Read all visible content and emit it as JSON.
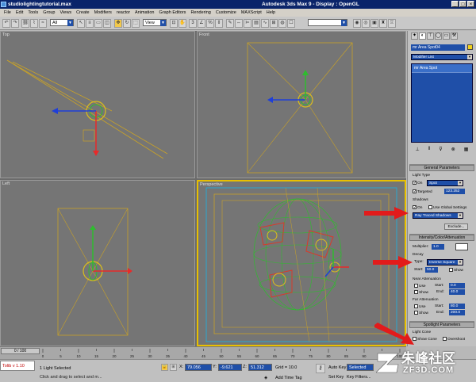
{
  "window": {
    "file_title": "studiolightingtutorial.max",
    "app_title": "Autodesk 3ds Max 9      - Display : OpenGL"
  },
  "menu": [
    "File",
    "Edit",
    "Tools",
    "Group",
    "Views",
    "Create",
    "Modifiers",
    "reactor",
    "Animation",
    "Graph Editors",
    "Rendering",
    "Customize",
    "MAXScript",
    "Help"
  ],
  "toolbar": {
    "selection_filter": "All",
    "ref_coord": "View",
    "named_set": ""
  },
  "viewports": {
    "top_label": "Top",
    "front_label": "Front",
    "left_label": "Left",
    "persp_label": "Perspective"
  },
  "command_panel": {
    "object_name": "mr Area Spot04",
    "object_color": "#f2d21a",
    "modifier_list": "Modifier List",
    "stack_item": "mr Area Spot",
    "general": {
      "header": "General Parameters",
      "light_type_label": "Light Type",
      "on_label": "On",
      "type_value": "Spot",
      "targeted_label": "Targeted",
      "targeted_value": "123.252",
      "shadows_label": "Shadows",
      "shadows_on_label": "On",
      "use_global_label": "Use Global Settings",
      "shadow_type": "Ray Traced Shadows",
      "exclude_label": "Exclude..."
    },
    "intensity": {
      "header": "Intensity/Color/Attenuation",
      "multiplier_label": "Multiplier:",
      "multiplier_value": "1.0",
      "decay_label": "Decay",
      "type_label": "Type:",
      "type_value": "Inverse Square",
      "start_label": "Start:",
      "start_value": "50.0",
      "show_label": "Show",
      "near_label": "Near Attenuation",
      "near_use": "Use",
      "near_start_label": "Start:",
      "near_start_value": "0.0",
      "near_show": "Show",
      "near_end_label": "End:",
      "near_end_value": "40.0",
      "far_label": "Far Attenuation",
      "far_use": "Use",
      "far_start_label": "Start:",
      "far_start_value": "80.0",
      "far_show": "Show",
      "far_end_label": "End:",
      "far_end_value": "200.0"
    },
    "spotlight": {
      "header": "Spotlight Parameters",
      "cone_label": "Light Cone",
      "show_cone": "Show Cone",
      "overshoot": "Overshoot"
    }
  },
  "timeline": {
    "frame": "0 / 100",
    "ticks": [
      "0",
      "5",
      "10",
      "15",
      "20",
      "25",
      "30",
      "35",
      "40",
      "45",
      "50",
      "55",
      "60",
      "65",
      "70",
      "75",
      "80",
      "85",
      "90",
      "95",
      "100"
    ]
  },
  "status": {
    "maxscript": "Tolib v 1.10",
    "selected": "1 Light Selected",
    "prompt": "Click and drag to select and m...",
    "x_label": "X:",
    "x_value": "79.056",
    "y_label": "Y:",
    "y_value": "-9.621",
    "z_label": "Z:",
    "z_value": "51.312",
    "grid": "Grid = 10.0",
    "add_time_tag": "Add Time Tag",
    "auto_key": "Auto Key",
    "selected_box": "Selected",
    "set_key": "Set Key",
    "key_filters": "Key Filters..."
  },
  "watermark": {
    "cn": "朱峰社区",
    "en": "ZF3D.COM"
  }
}
